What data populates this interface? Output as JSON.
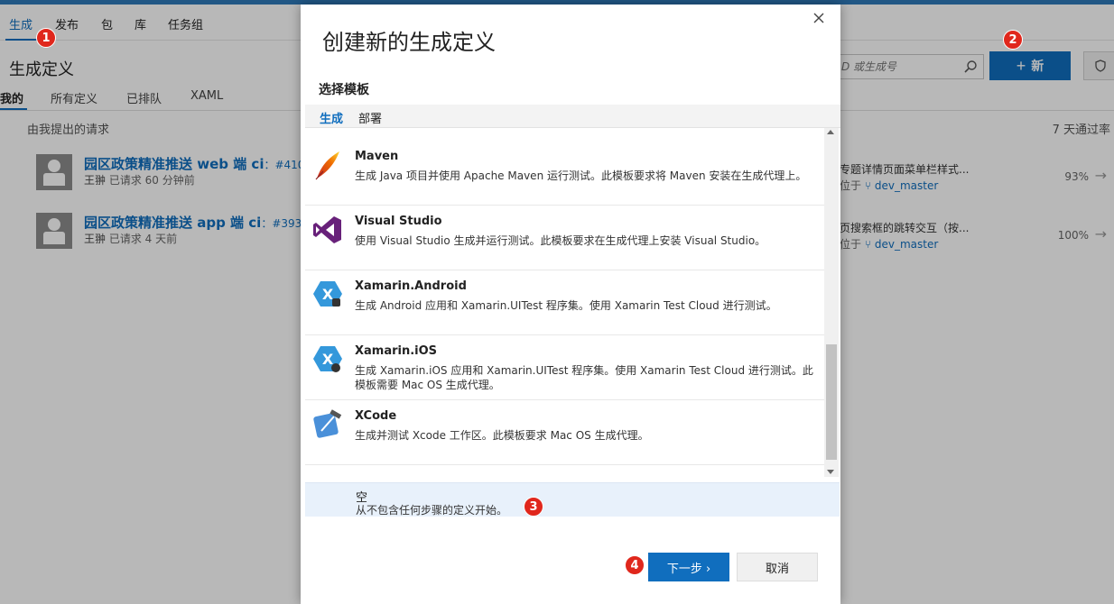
{
  "hub_tabs": [
    "生成",
    "发布",
    "包",
    "库",
    "任务组"
  ],
  "page": {
    "title": "生成定义",
    "subtabs": [
      "我的",
      "所有定义",
      "已排队",
      "XAML"
    ],
    "section_title": "由我提出的请求",
    "rate_title": "7 天通过率",
    "search_placeholder": "D 或生成号",
    "new_button": "新"
  },
  "requests": [
    {
      "title": "园区政策精准推送 web 端 ci",
      "num": "#410",
      "user": "王翀",
      "time": "已请求 60 分钟前"
    },
    {
      "title": "园区政策精准推送 app 端 ci",
      "num": "#393",
      "user": "王翀",
      "time": "已请求 4 天前"
    }
  ],
  "definitions": [
    {
      "text": "专题详情页面菜单栏样式...",
      "branch_prefix": "位于",
      "branch": "dev_master",
      "pct": "93%"
    },
    {
      "text": "页搜索框的跳转交互（按...",
      "branch_prefix": "位于",
      "branch": "dev_master",
      "pct": "100%"
    }
  ],
  "dialog": {
    "title": "创建新的生成定义",
    "subhead": "选择模板",
    "tabs": [
      "生成",
      "部署"
    ],
    "templates": [
      {
        "name": "Maven",
        "desc": "生成 Java 项目并使用 Apache Maven 运行测试。此模板要求将 Maven 安装在生成代理上。",
        "icon": "maven-feather-icon"
      },
      {
        "name": "Visual Studio",
        "desc": "使用 Visual Studio 生成并运行测试。此模板要求在生成代理上安装 Visual Studio。",
        "icon": "visual-studio-icon"
      },
      {
        "name": "Xamarin.Android",
        "desc": "生成 Android 应用和 Xamarin.UITest 程序集。使用 Xamarin Test Cloud 进行测试。",
        "icon": "xamarin-android-icon"
      },
      {
        "name": "Xamarin.iOS",
        "desc": "生成 Xamarin.iOS 应用和 Xamarin.UITest 程序集。使用 Xamarin Test Cloud 进行测试。此模板需要 Mac OS 生成代理。",
        "icon": "xamarin-ios-icon"
      },
      {
        "name": "XCode",
        "desc": "生成并测试 Xcode 工作区。此模板要求 Mac OS 生成代理。",
        "icon": "xcode-icon"
      }
    ],
    "empty": {
      "name": "空",
      "desc": "从不包含任何步骤的定义开始。"
    },
    "next_button": "下一步 ›",
    "cancel_button": "取消"
  },
  "badges": [
    "1",
    "2",
    "3",
    "4"
  ],
  "colors": {
    "accent": "#106ebe",
    "badge": "#e0271c"
  }
}
